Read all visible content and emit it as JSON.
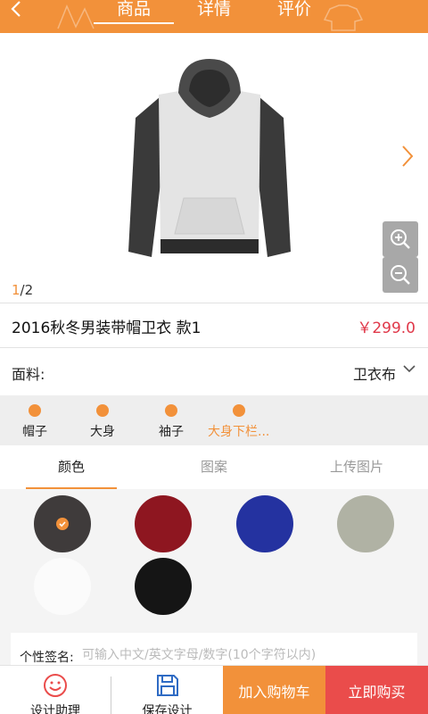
{
  "header": {
    "tabs": [
      {
        "label": "商品",
        "active": true
      },
      {
        "label": "详情",
        "active": false
      },
      {
        "label": "评价",
        "active": false
      }
    ],
    "accent": "#f2913a"
  },
  "gallery": {
    "current": "1",
    "total": "/2"
  },
  "product": {
    "name": "2016秋冬男装带帽卫衣  款1",
    "price": "￥299.0"
  },
  "fabric": {
    "label": "面料:",
    "value": "卫衣布"
  },
  "parts": [
    {
      "label": "帽子",
      "active": false
    },
    {
      "label": "大身",
      "active": false
    },
    {
      "label": "袖子",
      "active": false
    },
    {
      "label": "大身下栏...",
      "active": true
    }
  ],
  "subtabs": [
    {
      "label": "颜色",
      "active": true
    },
    {
      "label": "图案",
      "active": false
    },
    {
      "label": "上传图片",
      "active": false
    }
  ],
  "colors": [
    {
      "hex": "#3f3b3b",
      "selected": true
    },
    {
      "hex": "#8e1620",
      "selected": false
    },
    {
      "hex": "#2432a0",
      "selected": false
    },
    {
      "hex": "#b0b2a4",
      "selected": false
    },
    {
      "hex": "#fbfbfb",
      "selected": false
    },
    {
      "hex": "#151515",
      "selected": false
    }
  ],
  "signature": {
    "label": "个性签名:",
    "placeholder": "可输入中文/英文字母/数字(10个字符以内)"
  },
  "bottom_bar": {
    "assistant_label": "设计助理",
    "save_label": "保存设计",
    "cart_label": "加入购物车",
    "buy_label": "立即购买"
  }
}
